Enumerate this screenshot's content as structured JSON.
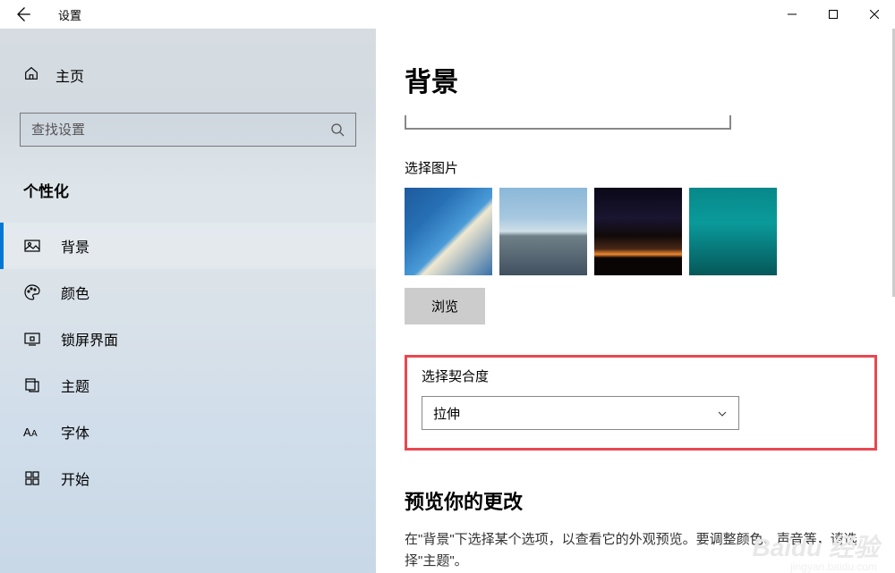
{
  "app": {
    "title": "设置"
  },
  "sidebar": {
    "home": "主页",
    "search_placeholder": "查找设置",
    "category": "个性化",
    "items": [
      {
        "label": "背景",
        "icon": "picture"
      },
      {
        "label": "颜色",
        "icon": "palette"
      },
      {
        "label": "锁屏界面",
        "icon": "lock-screen"
      },
      {
        "label": "主题",
        "icon": "theme"
      },
      {
        "label": "字体",
        "icon": "font"
      },
      {
        "label": "开始",
        "icon": "start"
      }
    ]
  },
  "main": {
    "title": "背景",
    "choose_picture_label": "选择图片",
    "browse_label": "浏览",
    "fit_label": "选择契合度",
    "fit_value": "拉伸",
    "preview_title": "预览你的更改",
    "preview_desc": "在\"背景\"下选择某个选项，以查看它的外观预览。要调整颜色、声音等，请选择\"主题\"。"
  },
  "watermark": {
    "main": "Baidu 经验",
    "sub": "jingyan.baidu.com"
  }
}
